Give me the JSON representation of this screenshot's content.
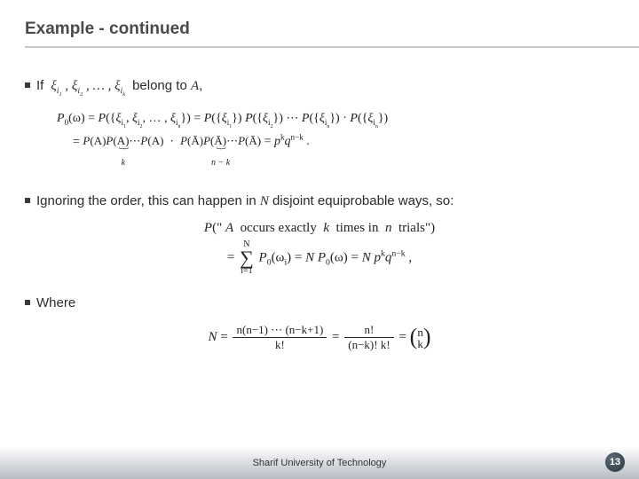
{
  "title": "Example - continued",
  "bullet1_prefix": "If",
  "bullet1_suffix_a": "belong to ",
  "bullet1_suffix_b": "A",
  "bullet1_suffix_c": ",",
  "xi_list": "ξ_{i₁} , ξ_{i₂} , … , ξ_{i_k}",
  "eq1_line1": "P₀(ω) = P({ξ_{i₁}, ξ_{i₂}, … , ξ_{i_n}}) = P({ξ_{i₁}}) P({ξ_{i₂}}) ⋯ P({ξ_{i_n}}) ⋅ P({ξ_{i_n}})",
  "eq1_ubrace1_expr": "P(A) P(A) ⋯ P(A)",
  "eq1_ubrace1_label": "k",
  "eq1_ubrace2_expr": "P(Ā) P(Ā) ⋯ P(Ā)",
  "eq1_ubrace2_label": "n − k",
  "eq1_tail": " = pᵏ qⁿ⁻ᵏ .",
  "bullet2_a": "Ignoring the order, this can happen in ",
  "bullet2_b": "N",
  "bullet2_c": " disjoint equiprobable ways, so:",
  "eq2_line1": "P(\" A  occurs exactly  k  times in  n  trials\")",
  "eq2_sum_top": "N",
  "eq2_sum_bot": "i=1",
  "eq2_after_sum": " P₀(ωᵢ) = N P₀(ω) = N pᵏ qⁿ⁻ᵏ ,",
  "bullet3": "Where",
  "eq3_N": "N = ",
  "eq3_frac1_num": "n(n−1) ⋯ (n−k+1)",
  "eq3_frac1_den": "k!",
  "eq3_mid": " = ",
  "eq3_frac2_num": "n!",
  "eq3_frac2_den": "(n−k)! k!",
  "eq3_eq": " = ",
  "eq3_binom_top": "n",
  "eq3_binom_bot": "k",
  "footer": "Sharif University of Technology",
  "page": "13"
}
